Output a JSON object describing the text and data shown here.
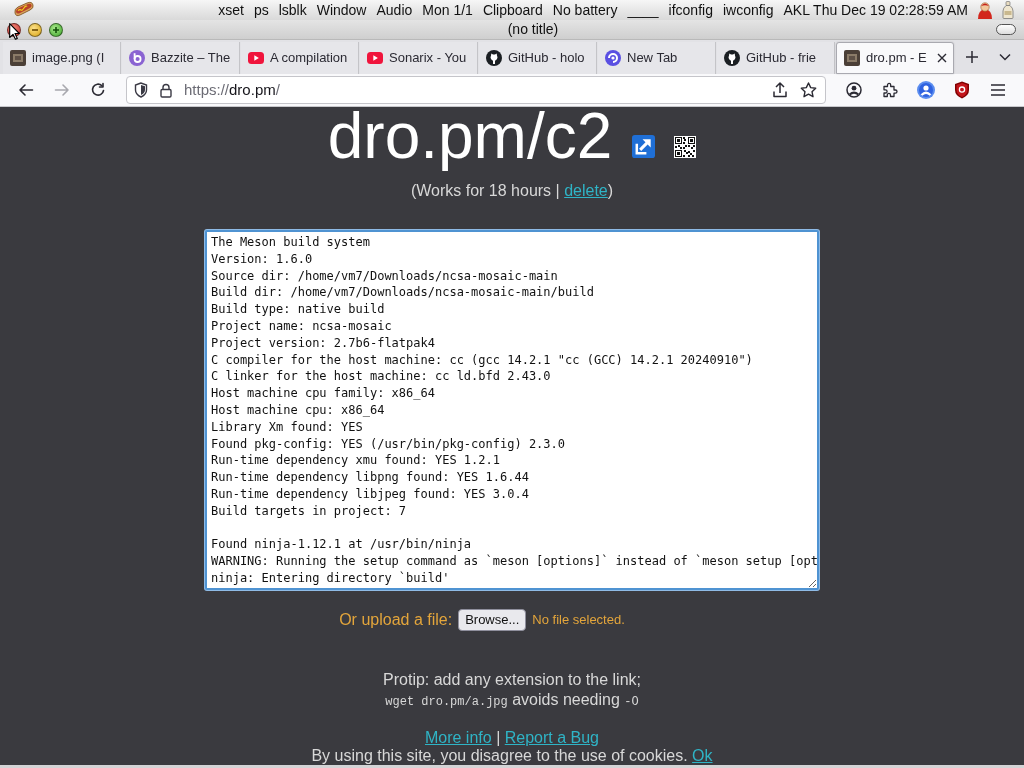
{
  "system_bar": {
    "items": [
      "xset",
      "ps",
      "lsblk",
      "Window",
      "Audio",
      "Mon 1/1",
      "Clipboard",
      "No battery",
      "____",
      "ifconfig",
      "iwconfig",
      "AKL Thu Dec 19 02:28:59 AM"
    ]
  },
  "window": {
    "title": "(no title)"
  },
  "tabs": [
    {
      "label": "image.png (I",
      "kind": "thumbnail",
      "selected": false
    },
    {
      "label": "Bazzite – The",
      "kind": "ring",
      "selected": false
    },
    {
      "label": "A compilation",
      "kind": "play",
      "selected": false
    },
    {
      "label": "Sonarix - You",
      "kind": "play",
      "selected": false
    },
    {
      "label": "GitHub - holo",
      "kind": "cat",
      "selected": false
    },
    {
      "label": "New Tab",
      "kind": "swirl",
      "selected": false
    },
    {
      "label": "GitHub - frie",
      "kind": "cat",
      "selected": false
    },
    {
      "label": "dro.pm - E",
      "kind": "thumbnail",
      "selected": true
    }
  ],
  "toolbar": {
    "nav_buttons": [
      {
        "kind": "back",
        "disabled": false
      },
      {
        "kind": "forward",
        "disabled": true
      },
      {
        "kind": "reload",
        "disabled": false
      }
    ],
    "address": {
      "scheme": "https://",
      "host": "dro.pm",
      "path": "/"
    }
  },
  "page": {
    "title": "dro.pm/c2",
    "expiry": {
      "text": "(Works for 18 hours |",
      "link": "delete",
      "end": ")"
    },
    "paste": {
      "value": "The Meson build system\nVersion: 1.6.0\nSource dir: /home/vm7/Downloads/ncsa-mosaic-main\nBuild dir: /home/vm7/Downloads/ncsa-mosaic-main/build\nBuild type: native build\nProject name: ncsa-mosaic\nProject version: 2.7b6-flatpak4\nC compiler for the host machine: cc (gcc 14.2.1 \"cc (GCC) 14.2.1 20240910\")\nC linker for the host machine: cc ld.bfd 2.43.0\nHost machine cpu family: x86_64\nHost machine cpu: x86_64\nLibrary Xm found: YES\nFound pkg-config: YES (/usr/bin/pkg-config) 2.3.0\nRun-time dependency xmu found: YES 1.2.1\nRun-time dependency libpng found: YES 1.6.44\nRun-time dependency libjpeg found: YES 3.0.4\nBuild targets in project: 7\n\nFound ninja-1.12.1 at /usr/bin/ninja\nWARNING: Running the setup command as `meson [options]` instead of `meson setup [opt\nninja: Entering directory `build'"
    },
    "upload": {
      "label": "Or upload a file:",
      "button": "Browse...",
      "status": "No file selected."
    },
    "protip": {
      "line": "Protip: add any extension to the link;",
      "command": "wget dro.pm/a.jpg",
      "text": "avoids needing",
      "flag": "-O"
    },
    "footer": {
      "links": [
        "More info",
        "Report a Bug"
      ],
      "separator": "|"
    },
    "cookie_notice": {
      "text": "By using this site, you disagree to the use of cookies.",
      "link": "Ok"
    }
  }
}
